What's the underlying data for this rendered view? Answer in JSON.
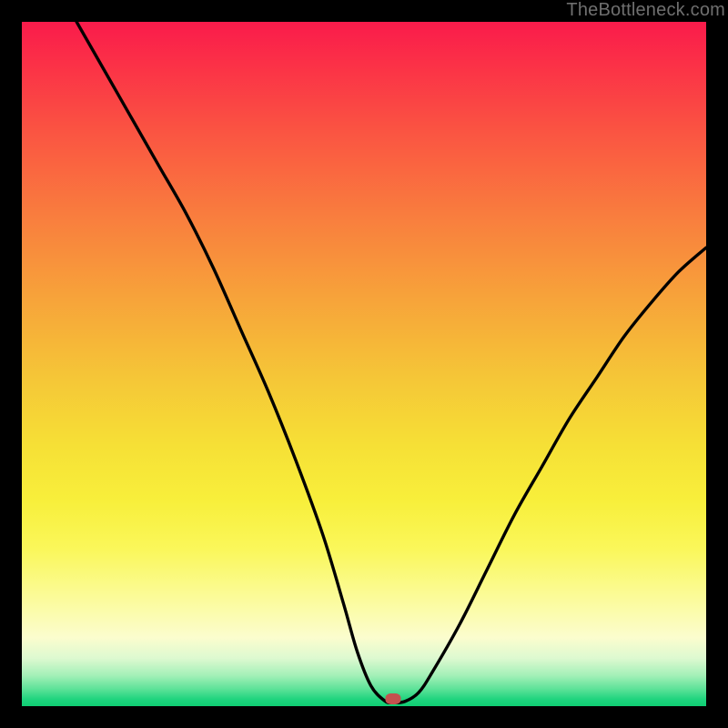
{
  "watermark": "TheBottleneck.com",
  "marker": {
    "x_pct": 54.2,
    "y_pct": 99.0
  },
  "chart_data": {
    "type": "line",
    "title": "",
    "xlabel": "",
    "ylabel": "",
    "xlim": [
      0,
      100
    ],
    "ylim": [
      0,
      100
    ],
    "grid": false,
    "legend": false,
    "note": "Percent-of-plot coordinates; y=0 at bottom (green), y=100 at top (red). Curve is a V-shaped bottleneck profile reaching ~0 near x≈54.",
    "series": [
      {
        "name": "bottleneck-curve",
        "x": [
          8.0,
          12,
          16,
          20,
          24,
          28,
          32,
          36,
          40,
          44,
          47,
          49,
          51,
          53,
          54.2,
          56,
          58,
          60,
          64,
          68,
          72,
          76,
          80,
          84,
          88,
          92,
          96,
          100
        ],
        "y": [
          100,
          93,
          86,
          79,
          72,
          64,
          55,
          46,
          36,
          25,
          15,
          8,
          3,
          0.8,
          0.5,
          0.7,
          2,
          5,
          12,
          20,
          28,
          35,
          42,
          48,
          54,
          59,
          63.5,
          67
        ]
      }
    ],
    "background_gradient": {
      "direction": "top-to-bottom",
      "stops": [
        {
          "pct": 0,
          "color": "#fa1b4b"
        },
        {
          "pct": 28,
          "color": "#f97c3e"
        },
        {
          "pct": 62,
          "color": "#f6e036"
        },
        {
          "pct": 90,
          "color": "#fbfdce"
        },
        {
          "pct": 100,
          "color": "#0fce73"
        }
      ]
    },
    "marker_point": {
      "x": 54.2,
      "y": 0.9,
      "color": "#c4524f"
    }
  }
}
